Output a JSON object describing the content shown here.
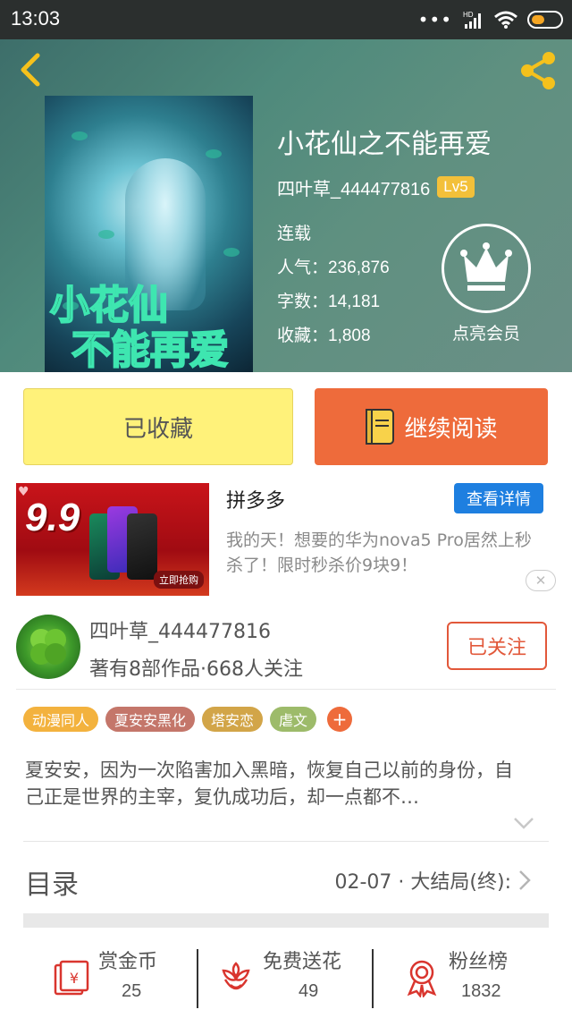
{
  "status_bar": {
    "time": "13:03",
    "network": "HD"
  },
  "book": {
    "title": "小花仙之不能再爱",
    "author": "四叶草_444477816",
    "level": "Lv5",
    "status": "连载",
    "popularity_label": "人气：",
    "popularity": "236,876",
    "words_label": "字数：",
    "words": "14,181",
    "favorites_label": "收藏：",
    "favorites": "1,808",
    "cover_text": "小花仙 不能再爱"
  },
  "vip": {
    "label": "点亮会员"
  },
  "actions": {
    "collect_label": "已收藏",
    "read_label": "继续阅读"
  },
  "ad": {
    "price": "9.9",
    "buy_label": "立即抢购",
    "brand": "拼多多",
    "detail_label": "查看详情",
    "text": "我的天！想要的华为nova5 Pro居然上秒杀了！限时秒杀价9块9！",
    "close_label": "✕"
  },
  "author_card": {
    "name": "四叶草_444477816",
    "subtitle": "著有8部作品·668人关注",
    "follow_label": "已关注"
  },
  "tags": [
    {
      "label": "动漫同人",
      "color": "#f3b23e"
    },
    {
      "label": "夏安安黑化",
      "color": "#c4766a"
    },
    {
      "label": "塔安恋",
      "color": "#d2a548"
    },
    {
      "label": "虐文",
      "color": "#9dbb6a"
    }
  ],
  "tag_add": "+",
  "intro": "夏安安，因为一次陷害加入黑暗，恢复自己以前的身份，自己正是世界的主宰，复仇成功后，却一点都不…",
  "toc": {
    "label": "目录",
    "latest": "02-07 · 大结局(终):"
  },
  "bottom_bar": [
    {
      "label": "赏金币",
      "count": "25",
      "icon": "red-envelope-icon"
    },
    {
      "label": "免费送花",
      "count": "49",
      "icon": "flower-icon"
    },
    {
      "label": "粉丝榜",
      "count": "1832",
      "icon": "medal-icon"
    }
  ],
  "colors": {
    "accent": "#ee6b3b",
    "collect": "#fff27a",
    "ad_button": "#1e7fe0",
    "icon_red": "#d9352e"
  }
}
